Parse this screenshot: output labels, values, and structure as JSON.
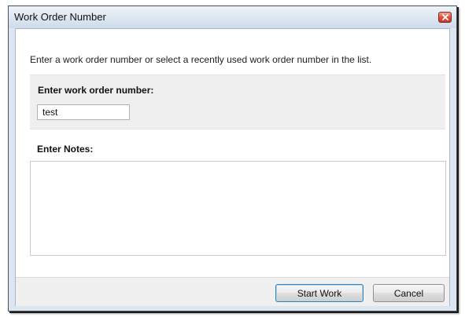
{
  "window": {
    "title": "Work Order Number",
    "close_icon": "close-icon"
  },
  "dialog": {
    "instruction": "Enter a work order number or select a recently used work order number in the list.",
    "work_order_label": "Enter work order number:",
    "work_order_value": "test",
    "notes_label": "Enter Notes:",
    "notes_value": ""
  },
  "buttons": {
    "start_label": "Start Work",
    "cancel_label": "Cancel"
  },
  "colors": {
    "close_button": "#d9543c",
    "default_button_border": "#3c7fb1",
    "panel_background": "#efefef"
  }
}
